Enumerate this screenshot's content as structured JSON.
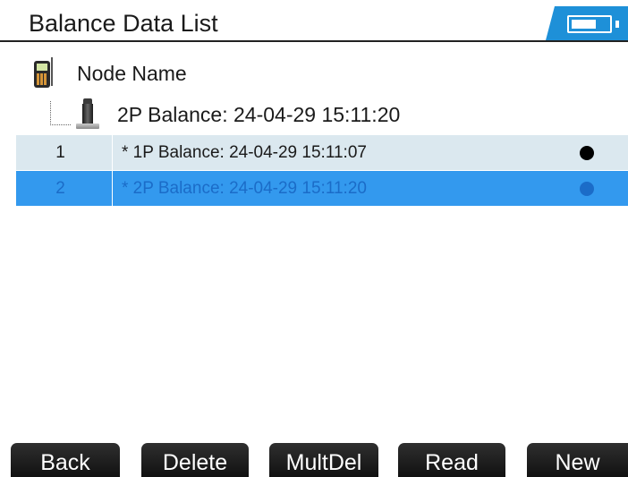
{
  "header": {
    "title": "Balance Data List"
  },
  "tree": {
    "root_label": "Node Name",
    "root_icon": "meter-icon",
    "child_label": "2P Balance: 24-04-29 15:11:20",
    "child_icon": "sensor-icon"
  },
  "list": {
    "rows": [
      {
        "index": "1",
        "name": "* 1P Balance: 24-04-29 15:11:07",
        "selected": false
      },
      {
        "index": "2",
        "name": "* 2P Balance: 24-04-29 15:11:20",
        "selected": true
      }
    ]
  },
  "buttons": {
    "back": "Back",
    "delete": "Delete",
    "multdel": "MultDel",
    "read": "Read",
    "new": "New"
  },
  "colors": {
    "accent": "#1e90d8",
    "selected_row": "#3399ee",
    "selected_text": "#1b6cc8",
    "normal_row": "#dbe8ef"
  }
}
